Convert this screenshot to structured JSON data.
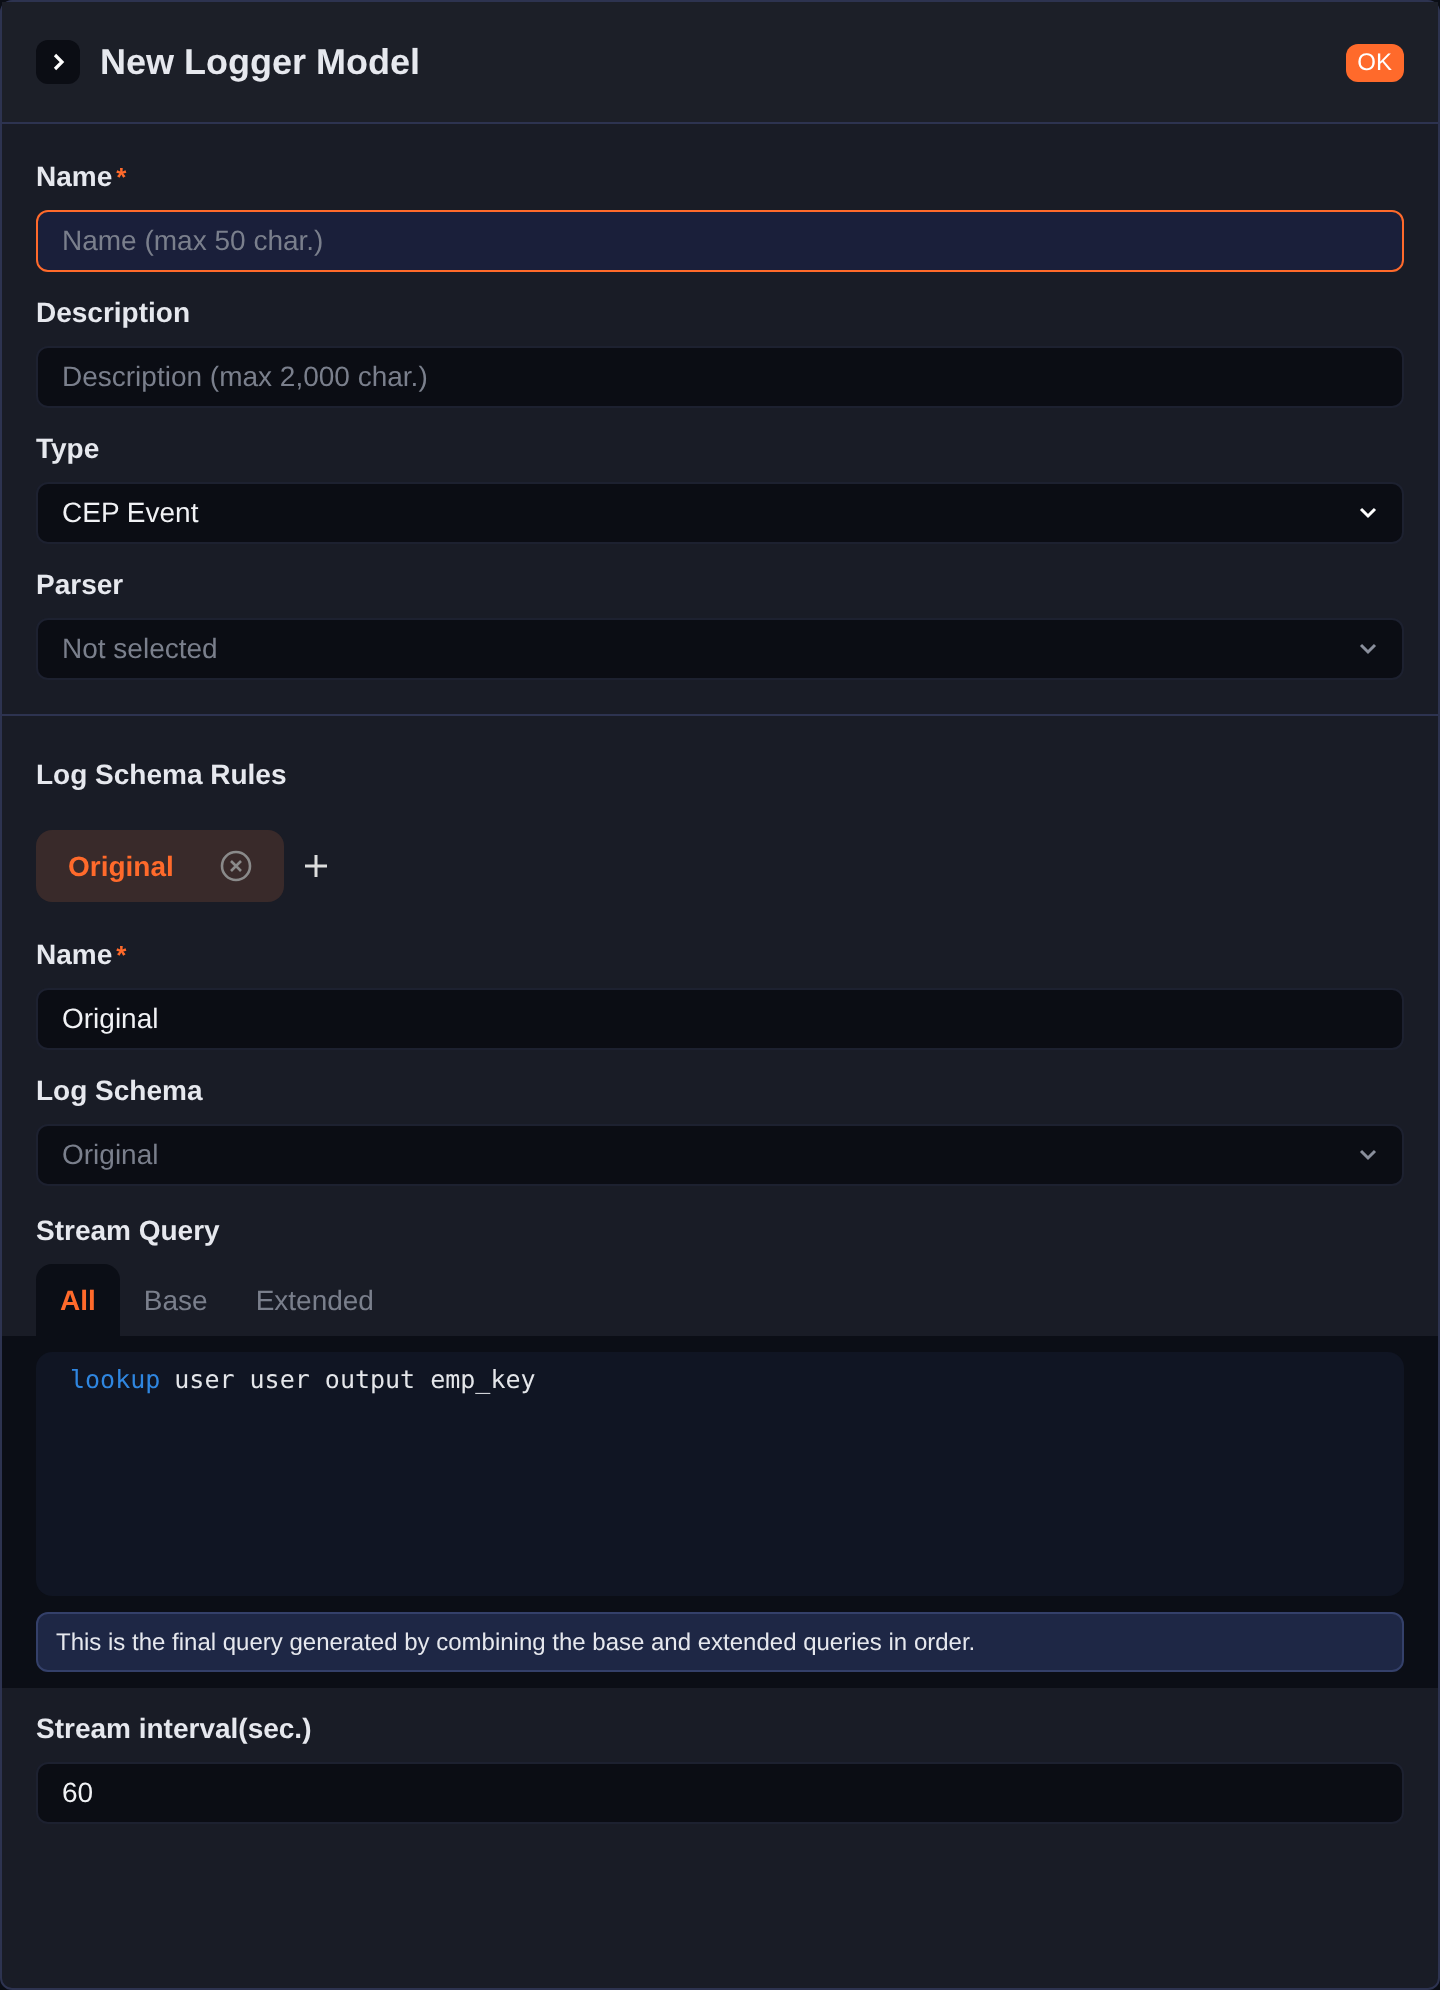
{
  "header": {
    "title": "New Logger Model",
    "ok_button": "OK"
  },
  "fields": [
    {
      "kind": "input",
      "label": "Name",
      "required_mark": "*",
      "placeholder": "Name (max 50 char.)",
      "focused": true
    },
    {
      "kind": "input",
      "label": "Description",
      "placeholder": "Description (max 2,000 char.)",
      "focused": false
    },
    {
      "kind": "select",
      "label": "Type",
      "value": "CEP Event",
      "focused": false
    },
    {
      "kind": "select",
      "label": "Parser",
      "placeholder": "Not selected",
      "focused": false
    }
  ],
  "rules": {
    "title": "Log Schema Rules",
    "chips": [
      {
        "label": "Original",
        "selected": true
      }
    ],
    "fields": [
      {
        "kind": "input",
        "label": "Name",
        "required_mark": "*",
        "value": "Original",
        "focused": false
      },
      {
        "kind": "select",
        "label": "Log Schema",
        "placeholder": "Original",
        "focused": false
      }
    ]
  },
  "stream_query": {
    "label": "Stream Query",
    "tabs": [
      {
        "label": "All",
        "selected": true
      },
      {
        "label": "Base",
        "selected": false
      },
      {
        "label": "Extended",
        "selected": false
      }
    ],
    "code": [
      {
        "kind": "keyword",
        "text": "lookup"
      },
      {
        "kind": "plain",
        "text": "user user output emp_key"
      }
    ],
    "info": "This is the final query generated by combining the base and extended queries in order."
  },
  "interval": {
    "label": "Stream interval(sec.)",
    "value": "60",
    "focused": false
  }
}
